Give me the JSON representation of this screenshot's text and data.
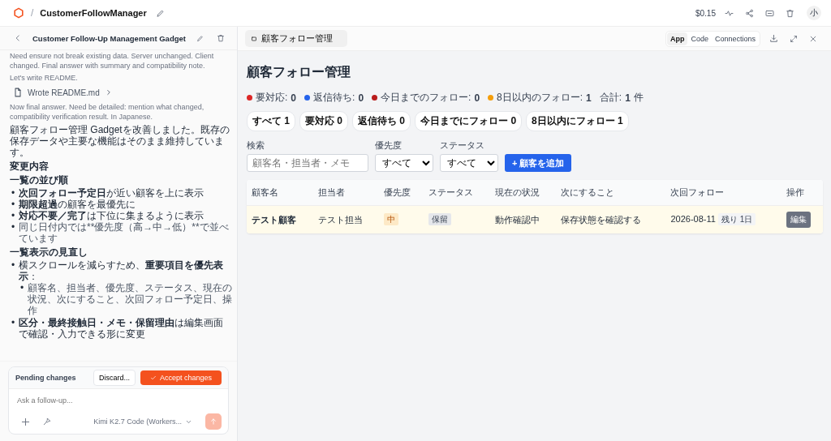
{
  "header": {
    "separator": "/",
    "project": "CustomerFollowManager",
    "cost": "$0.15",
    "avatar": "小"
  },
  "chat": {
    "title": "Customer Follow-Up Management Gadget",
    "blocks": [
      {
        "kind": "note",
        "text": "Need ensure not break existing data. Server unchanged. Client changed. Final answer with summary and compatibility note."
      },
      {
        "kind": "note",
        "text": "Let's write README."
      },
      {
        "kind": "file",
        "text": "Wrote README.md"
      },
      {
        "kind": "note",
        "text": "Now final answer. Need be detailed: mention what changed, compatibility verification result. In Japanese."
      },
      {
        "kind": "paragraph",
        "text": "顧客フォロー管理 Gadgetを改善しました。既存の保存データや主要な機能はそのまま維持しています。"
      },
      {
        "kind": "heading",
        "text": "変更内容"
      },
      {
        "kind": "subheading",
        "text": "一覧の並び順"
      },
      {
        "kind": "list",
        "items": [
          {
            "marker": "•",
            "kind": "rich",
            "text": "**次回フォロー予定日**が近い顧客を上に表示"
          },
          {
            "marker": "•",
            "kind": "rich",
            "text": "**期限超過**の顧客を最優先に"
          },
          {
            "marker": "•",
            "kind": "rich",
            "text": "**対応不要／完了**は下位に集まるように表示"
          },
          {
            "marker": "•",
            "kind": "plain",
            "text": "同じ日付内では**優先度（高→中→低）**で並べています"
          }
        ]
      },
      {
        "kind": "subheading",
        "text": "一覧表示の見直し"
      },
      {
        "kind": "list",
        "items": [
          {
            "marker": "•",
            "kind": "rich",
            "text": "横スクロールを減らすため、**重要項目を優先表示**：",
            "children": [
              {
                "marker": "•",
                "kind": "plain",
                "text": "顧客名、担当者、優先度、ステータス、現在の状況、次にすること、次回フォロー予定日、操作"
              }
            ]
          },
          {
            "marker": "•",
            "kind": "rich",
            "text": "**区分・最終接触日・メモ・保留理由**は編集画面で確認・入力できる形に変更"
          }
        ]
      }
    ]
  },
  "pending": {
    "label": "Pending changes",
    "discard": "Discard...",
    "accept": "Accept changes"
  },
  "composer": {
    "placeholder": "Ask a follow-up...",
    "model": "Kimi K2.7 Code (Workers..."
  },
  "preview": {
    "tab_title": "顧客フォロー管理",
    "view_tabs": [
      {
        "label": "App",
        "selected": true
      },
      {
        "label": "Code",
        "selected": false
      },
      {
        "label": "Connections",
        "selected": false
      }
    ]
  },
  "app": {
    "title": "顧客フォロー管理",
    "stats": [
      {
        "label": "要対応:",
        "value": "0",
        "color": "#dc2626"
      },
      {
        "label": "返信待ち:",
        "value": "0",
        "color": "#2563eb"
      },
      {
        "label": "今日までのフォロー:",
        "value": "0",
        "color": "#b91c1c"
      },
      {
        "label": "8日以内のフォロー:",
        "value": "1",
        "color": "#f59e0b"
      }
    ],
    "total": {
      "label": "合計:",
      "value": "1",
      "unit": "件"
    },
    "chips": [
      {
        "label": "すべて 1",
        "selected": false
      },
      {
        "label": "要対応 0",
        "selected": false
      },
      {
        "label": "返信待ち 0",
        "selected": false
      },
      {
        "label": "今日までにフォロー 0",
        "selected": false
      },
      {
        "label": "8日以内にフォロー 1",
        "selected": false
      }
    ],
    "search": {
      "label": "検索",
      "placeholder": "顧客名・担当者・メモ"
    },
    "priority_filter": {
      "label": "優先度",
      "value": "すべて"
    },
    "status_filter": {
      "label": "ステータス",
      "value": "すべて"
    },
    "add_button": "+ 顧客を追加",
    "table": {
      "columns": [
        "顧客名",
        "担当者",
        "優先度",
        "ステータス",
        "現在の状況",
        "次にすること",
        "次回フォロー",
        "操作"
      ],
      "rows": [
        {
          "name": "テスト顧客",
          "owner": "テスト担当",
          "priority": "中",
          "status": "保留",
          "situation": "動作確認中",
          "next_action": "保存状態を確認する",
          "next_follow": "2026-08-11",
          "remaining": "残り 1日",
          "action": "編集"
        }
      ]
    }
  }
}
